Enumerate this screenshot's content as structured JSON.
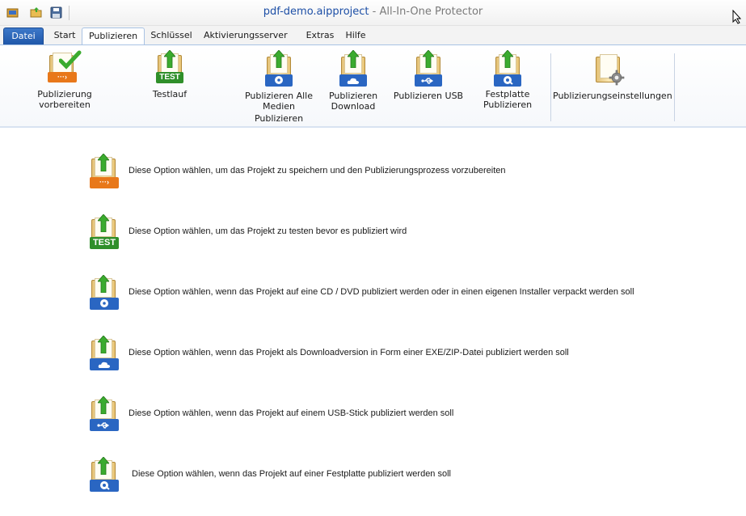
{
  "window": {
    "title_file": "pdf-demo.aipproject",
    "title_app": " - All-In-One Protector"
  },
  "tabs": [
    {
      "label": "Datei"
    },
    {
      "label": "Start"
    },
    {
      "label": "Publizieren"
    },
    {
      "label": "Schlüssel"
    },
    {
      "label": "Aktivierungsserver"
    },
    {
      "label": "Extras"
    },
    {
      "label": "Hilfe"
    }
  ],
  "ribbon": {
    "prepare": {
      "label": "Publizierung vorbereiten",
      "icon": "folder-check-icon"
    },
    "test": {
      "label": "Testlauf",
      "badge": "TEST",
      "icon": "folder-test-icon"
    },
    "all_media": {
      "label_lines": [
        "Publizieren Alle",
        "Medien",
        "Publizieren"
      ],
      "icon": "folder-disc-icon"
    },
    "download": {
      "label_lines": [
        "Publizieren",
        "Download"
      ],
      "icon": "folder-cloud-icon"
    },
    "usb": {
      "label": "Publizieren USB",
      "icon": "folder-usb-icon"
    },
    "harddisk": {
      "label_lines": [
        "Festplatte",
        "Publizieren"
      ],
      "icon": "folder-harddisk-icon"
    },
    "settings": {
      "label": "Publizierungseinstellungen",
      "icon": "folder-gear-icon"
    }
  },
  "options": [
    {
      "text": "Diese Option wählen, um das Projekt zu speichern und den Publizierungsprozess vorzubereiten",
      "icon": "folder-prepare-icon"
    },
    {
      "text": "Diese Option wählen, um das Projekt zu testen bevor es publiziert wird",
      "icon": "folder-test-icon",
      "badge": "TEST"
    },
    {
      "text": "Diese Option wählen, wenn das Projekt auf eine CD / DVD publiziert werden oder in einen eigenen Installer verpackt werden soll",
      "icon": "folder-disc-icon"
    },
    {
      "text": "Diese Option wählen, wenn das Projekt als Downloadversion in Form einer EXE/ZIP-Datei publiziert werden soll",
      "icon": "folder-cloud-icon"
    },
    {
      "text": "Diese Option wählen, wenn das Projekt auf einem USB-Stick publiziert werden soll",
      "icon": "folder-usb-icon"
    },
    {
      "text": "Diese Option wählen, wenn das Projekt auf einer Festplatte publiziert werden soll",
      "icon": "folder-harddisk-icon"
    }
  ],
  "colors": {
    "accent_blue": "#1e56a8",
    "arrow_green": "#3bab2e",
    "badge_orange": "#e8781a",
    "badge_green": "#2f8f2a",
    "badge_blue": "#2a66c2"
  }
}
